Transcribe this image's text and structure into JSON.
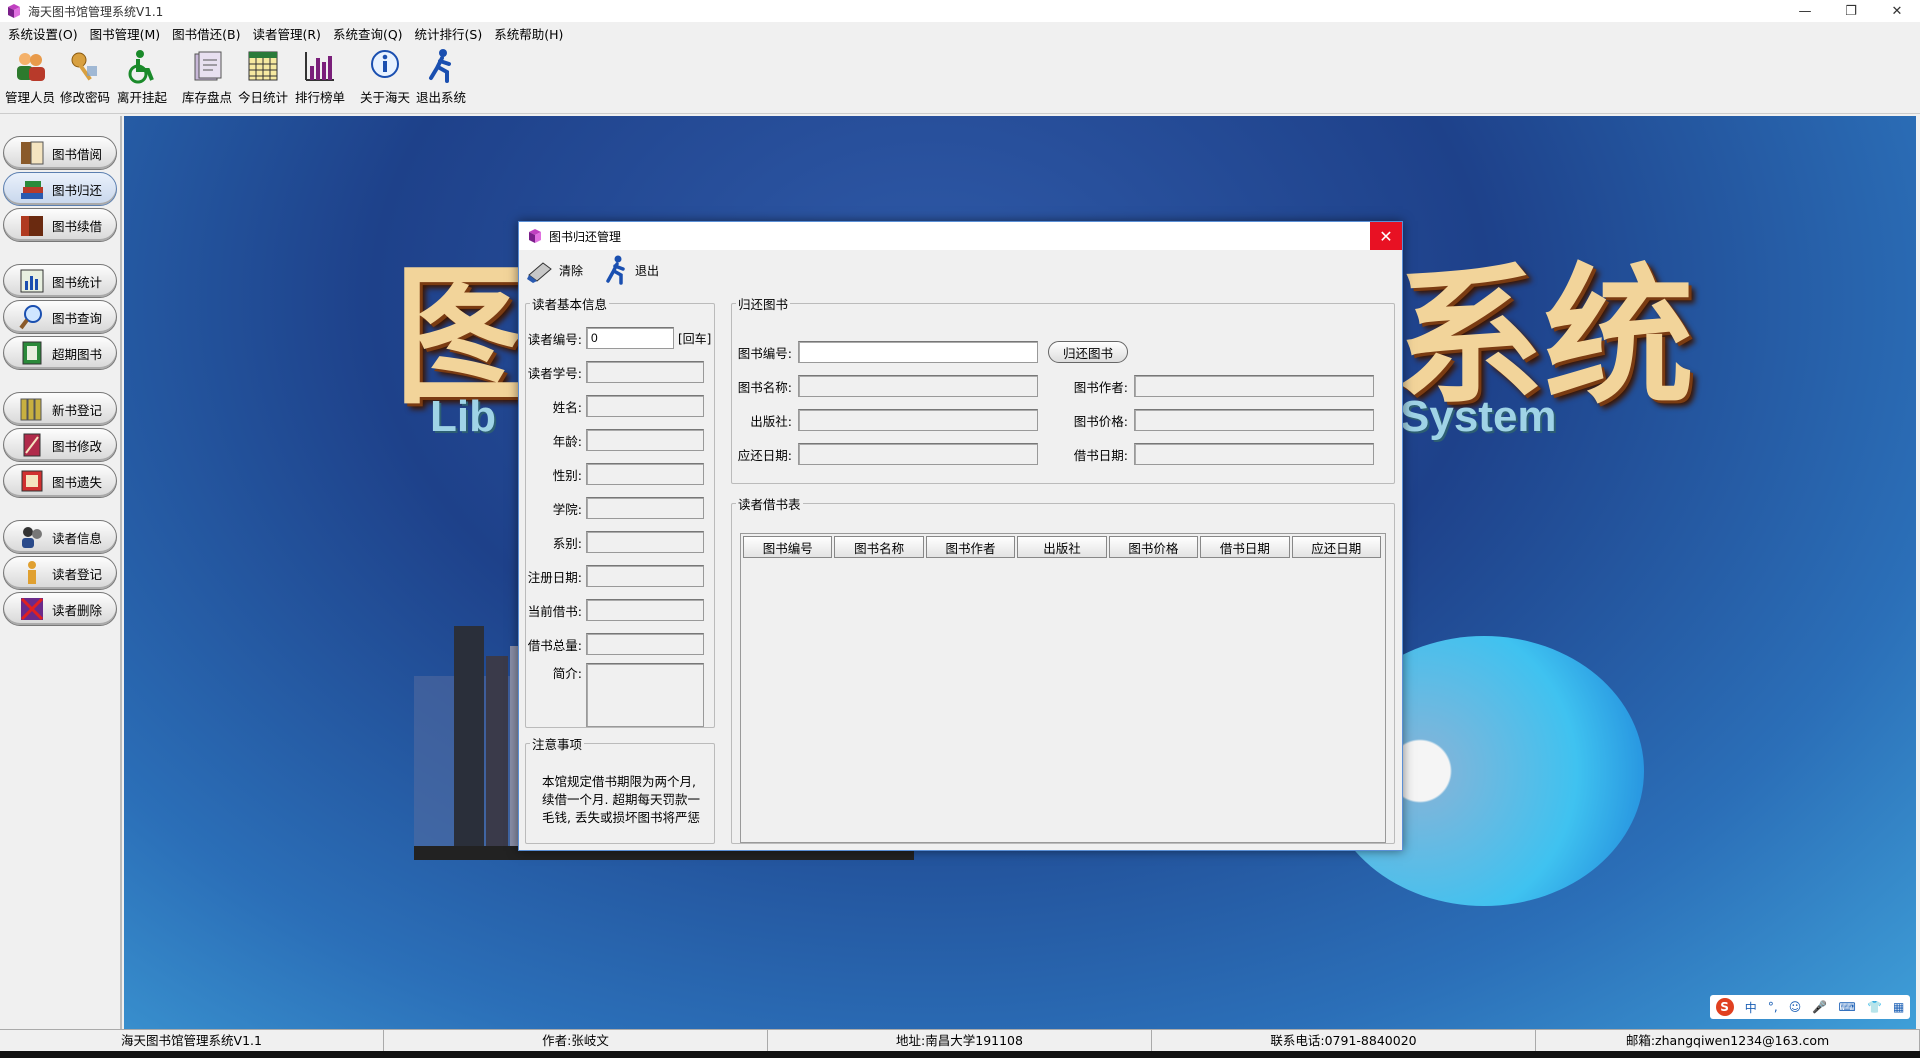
{
  "window": {
    "title": "海天图书馆管理系统V1.1",
    "min": "—",
    "restore": "❐",
    "close": "✕"
  },
  "menu": [
    "系统设置(O)",
    "图书管理(M)",
    "图书借还(B)",
    "读者管理(R)",
    "系统查询(Q)",
    "统计排行(S)",
    "系统帮助(H)"
  ],
  "toolbar": [
    {
      "label": "管理人员",
      "icon": "users-icon"
    },
    {
      "label": "修改密码",
      "icon": "key-icon"
    },
    {
      "label": "离开挂起",
      "icon": "wheelchair-icon"
    },
    {
      "label": "库存盘点",
      "icon": "inventory-icon"
    },
    {
      "label": "今日统计",
      "icon": "calendar-icon"
    },
    {
      "label": "排行榜单",
      "icon": "chart-icon"
    },
    {
      "label": "关于海天",
      "icon": "info-icon"
    },
    {
      "label": "退出系统",
      "icon": "exit-runner-icon"
    }
  ],
  "sidebar": [
    {
      "label": "图书借阅",
      "icon": "book-borrow-icon",
      "active": false
    },
    {
      "label": "图书归还",
      "icon": "book-return-icon",
      "active": true
    },
    {
      "label": "图书续借",
      "icon": "book-renew-icon",
      "active": false
    },
    {
      "label": "图书统计",
      "icon": "book-stats-icon",
      "active": false
    },
    {
      "label": "图书查询",
      "icon": "magnifier-icon",
      "active": false
    },
    {
      "label": "超期图书",
      "icon": "overdue-book-icon",
      "active": false
    },
    {
      "label": "新书登记",
      "icon": "new-book-icon",
      "active": false
    },
    {
      "label": "图书修改",
      "icon": "book-edit-icon",
      "active": false
    },
    {
      "label": "图书遗失",
      "icon": "book-lost-icon",
      "active": false
    },
    {
      "label": "读者信息",
      "icon": "reader-info-icon",
      "active": false
    },
    {
      "label": "读者登记",
      "icon": "reader-register-icon",
      "active": false
    },
    {
      "label": "读者删除",
      "icon": "reader-delete-icon",
      "active": false
    }
  ],
  "background": {
    "title_left": "图",
    "title_right": "系统",
    "sub_left": "Lib",
    "sub_right": "System"
  },
  "ime": [
    "S",
    "中",
    "°,",
    "☺",
    "🎤",
    "⌨",
    "👕",
    "▦"
  ],
  "dialog": {
    "title": "图书归还管理",
    "close": "✕",
    "tools": [
      {
        "label": "清除",
        "icon": "clear-icon"
      },
      {
        "label": "退出",
        "icon": "exit-runner-icon"
      }
    ],
    "reader_group": "读者基本信息",
    "reader_fields": [
      {
        "label": "读者编号:",
        "value": "0"
      },
      {
        "label": "读者学号:",
        "value": ""
      },
      {
        "label": "姓名:",
        "value": ""
      },
      {
        "label": "年龄:",
        "value": ""
      },
      {
        "label": "性别:",
        "value": ""
      },
      {
        "label": "学院:",
        "value": ""
      },
      {
        "label": "系别:",
        "value": ""
      },
      {
        "label": "注册日期:",
        "value": ""
      },
      {
        "label": "当前借书:",
        "value": ""
      },
      {
        "label": "借书总量:",
        "value": ""
      }
    ],
    "enter_hint": "[回车]",
    "intro_label": "简介:",
    "intro_value": "",
    "notice_group": "注意事项",
    "notice_text": "本馆规定借书期限为两个月,续借一个月. 超期每天罚款一毛钱, 丢失或损坏图书将严惩",
    "return_group": "归还图书",
    "return_button": "归还图书",
    "book_fields_left": [
      {
        "label": "图书编号:",
        "value": ""
      },
      {
        "label": "图书名称:",
        "value": ""
      },
      {
        "label": "出版社:",
        "value": ""
      },
      {
        "label": "应还日期:",
        "value": ""
      }
    ],
    "book_fields_right": [
      {
        "label": "图书作者:",
        "value": ""
      },
      {
        "label": "图书价格:",
        "value": ""
      },
      {
        "label": "借书日期:",
        "value": ""
      }
    ],
    "borrow_group": "读者借书表",
    "columns": [
      "图书编号",
      "图书名称",
      "图书作者",
      "出版社",
      "图书价格",
      "借书日期",
      "应还日期"
    ]
  },
  "status": [
    "海天图书馆管理系统V1.1",
    "作者:张岐文",
    "地址:南昌大学191108",
    "联系电话:0791-8840020",
    "邮箱:zhangqiwen1234@163.com"
  ]
}
